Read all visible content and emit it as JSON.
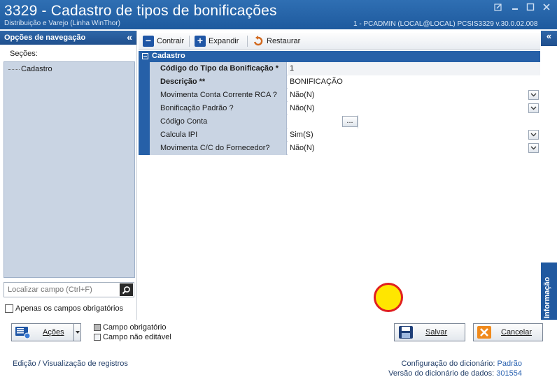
{
  "window": {
    "title": "3329 - Cadastro de tipos de bonificações",
    "subtitle": "Distribuição e Varejo (Linha WinThor)",
    "user_info": "1 - PCADMIN (LOCAL@LOCAL)   PCSIS3329  v.30.0.02.008"
  },
  "nav": {
    "header": "Opções de navegação",
    "collapse_glyph": "«",
    "sections_label": "Seções:",
    "sections": [
      {
        "label": "Cadastro"
      }
    ],
    "search_placeholder": "Localizar campo (Ctrl+F)",
    "only_required_label": "Apenas os campos obrigatórios"
  },
  "toolbar": {
    "collapse_label": "Contrair",
    "expand_label": "Expandir",
    "restore_label": "Restaurar"
  },
  "form": {
    "section_title": "Cadastro",
    "fields": [
      {
        "label": "Código do Tipo da Bonificação *",
        "value": "1"
      },
      {
        "label": "Descrição **",
        "value": "BONIFICAÇÃO"
      },
      {
        "label": "Movimenta Conta Corrente RCA ?",
        "value": "Não(N)"
      },
      {
        "label": "Bonificação Padrão ?",
        "value": "Não(N)"
      },
      {
        "label": "Código Conta",
        "value": "",
        "button": "..."
      },
      {
        "label": "Calcula IPI",
        "value": "Sim(S)"
      },
      {
        "label": "Movimenta C/C do Fornecedor?",
        "value": "Não(N)"
      }
    ]
  },
  "info_panel": {
    "label": "Informação",
    "collapse_glyph": "«"
  },
  "footer": {
    "actions_label": "Ações",
    "legend_required": "Campo obrigatório",
    "legend_not_editable": "Campo não editável",
    "save_label": "Salvar",
    "cancel_label": "Cancelar",
    "status_left": "Edição / Visualização de registros",
    "dict_config_label": "Configuração do dicionário:",
    "dict_config_value": "Padrão",
    "dict_version_label": "Versão do dicionário de dados:",
    "dict_version_value": "301554"
  },
  "colors": {
    "accent": "#2660a8",
    "label_bg": "#c9d4e3",
    "cancel_icon": "#f08a1c"
  }
}
